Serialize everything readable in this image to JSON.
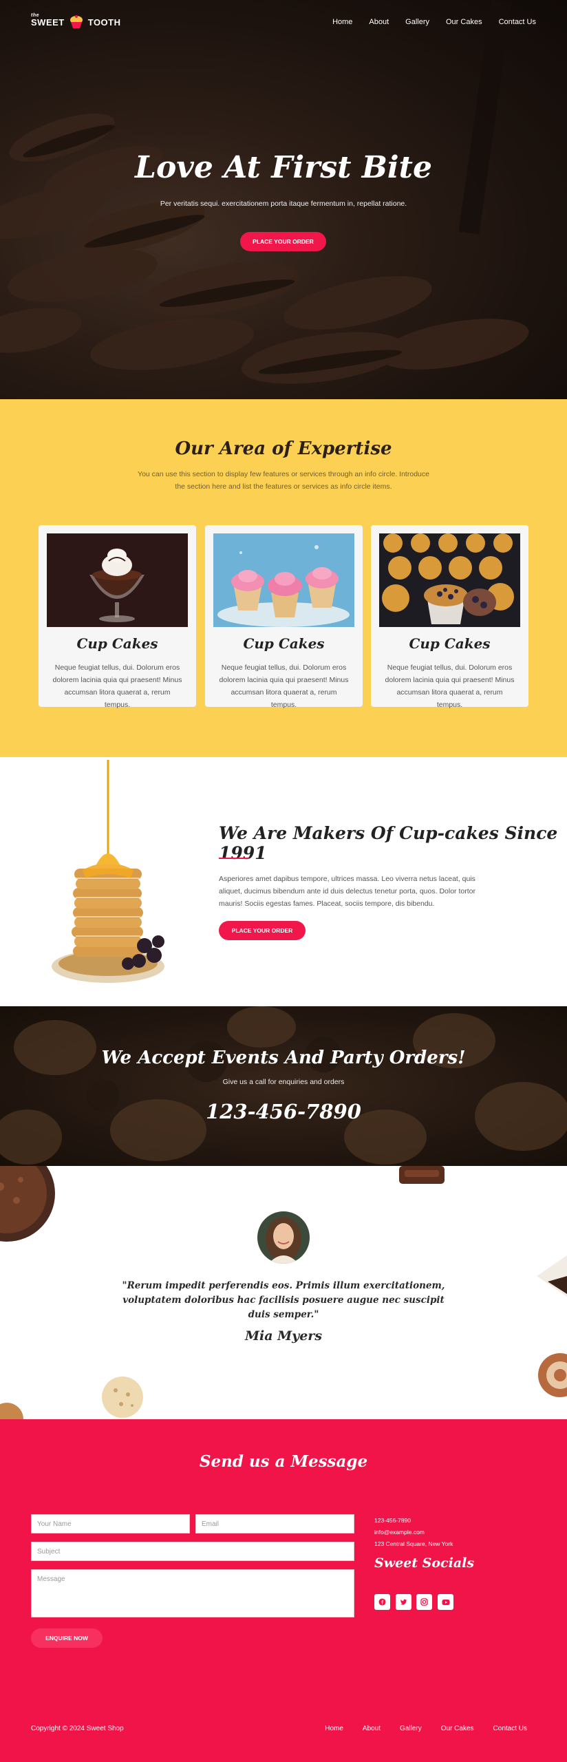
{
  "header": {
    "logo_small": "the",
    "logo_left": "SWEET",
    "logo_right": "TOOTH",
    "nav": [
      "Home",
      "About",
      "Gallery",
      "Our Cakes",
      "Contact Us"
    ]
  },
  "hero": {
    "title": "Love At First Bite",
    "subtitle": "Per veritatis sequi. exercitationem porta itaque fermentum in, repellat ratione.",
    "button": "PLACE YOUR ORDER"
  },
  "expertise": {
    "title": "Our Area of Expertise",
    "description": "You can use this section to display few features or services through an info circle. Introduce the section here and list the features or services as info circle items.",
    "cards": [
      {
        "title": "Cup Cakes",
        "text": "Neque feugiat tellus, dui. Dolorum eros dolorem lacinia quia qui praesent! Minus accumsan litora quaerat a, rerum tempus."
      },
      {
        "title": "Cup Cakes",
        "text": "Neque feugiat tellus, dui. Dolorum eros dolorem lacinia quia qui praesent! Minus accumsan litora quaerat a, rerum tempus."
      },
      {
        "title": "Cup Cakes",
        "text": "Neque feugiat tellus, dui. Dolorum eros dolorem lacinia quia qui praesent! Minus accumsan litora quaerat a, rerum tempus."
      }
    ]
  },
  "makers": {
    "title": "We Are Makers Of Cup-cakes Since 1991",
    "text": "Asperiores amet dapibus tempore, ultrices massa. Leo viverra netus laceat, quis aliquet, ducimus bibendum ante id duis delectus tenetur porta, quos. Dolor tortor mauris! Sociis egestas fames. Placeat, sociis tempore, dis bibendu.",
    "button": "PLACE YOUR ORDER"
  },
  "events": {
    "title": "We Accept Events And Party Orders!",
    "subtitle": "Give us a call for enquiries and orders",
    "phone": "123-456-7890"
  },
  "testimonial": {
    "quote": "\"Rerum impedit perferendis eos. Primis illum exercitationem, voluptatem doloribus hac facilisis posuere augue nec suscipit duis semper.\"",
    "name": "Mia Myers"
  },
  "contact": {
    "title": "Send us a Message",
    "name_placeholder": "Your Name",
    "email_placeholder": "Email",
    "subject_placeholder": "Subject",
    "message_placeholder": "Message",
    "button": "ENQUIRE NOW",
    "phone": "123-456-7890",
    "email": "info@example.com",
    "address": "123 Central Square, New York",
    "socials_title": "Sweet Socials",
    "socials": [
      "facebook-icon",
      "twitter-icon",
      "instagram-icon",
      "youtube-icon"
    ]
  },
  "footer": {
    "copyright": "Copyright © 2024 Sweet Shop",
    "nav": [
      "Home",
      "About",
      "Gallery",
      "Our Cakes",
      "Contact Us"
    ]
  },
  "colors": {
    "brand_pink": "#f01449",
    "brand_yellow": "#fcd153"
  }
}
